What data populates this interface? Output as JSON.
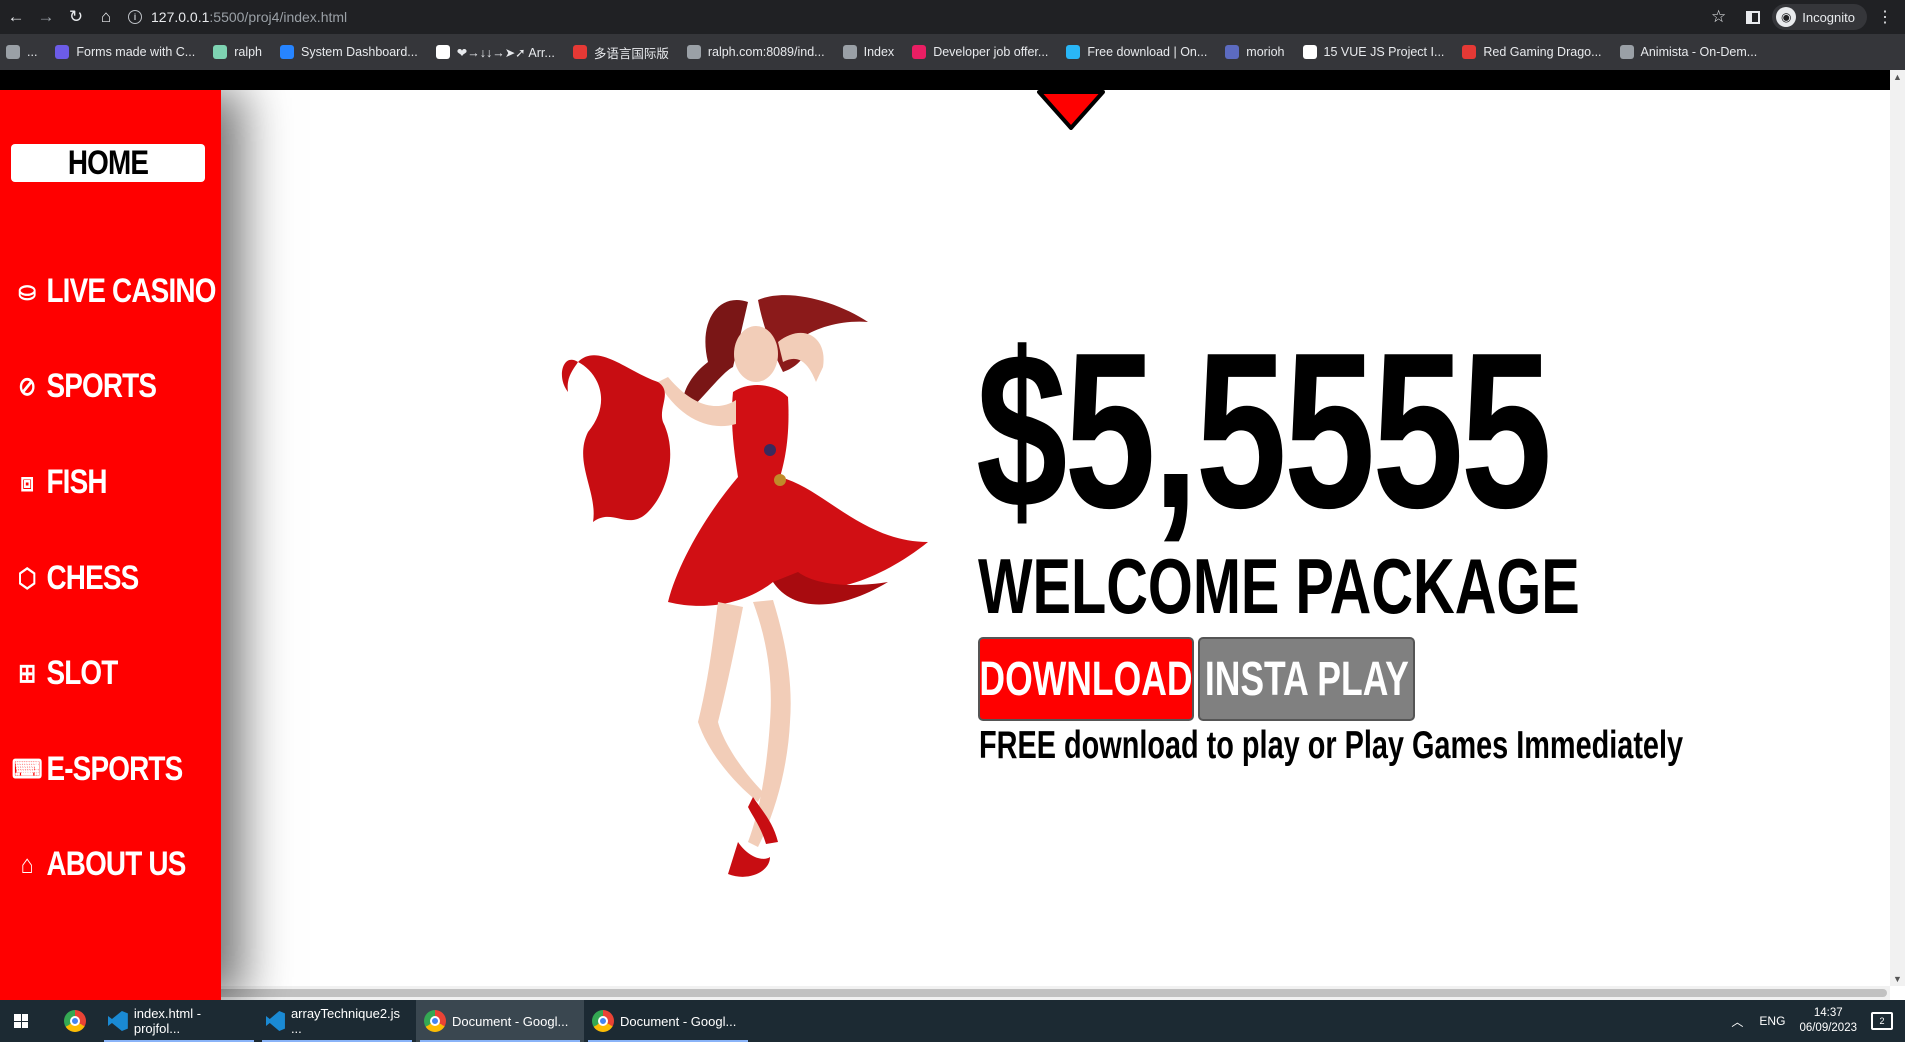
{
  "browser": {
    "url_host": "127.0.0.1",
    "url_path": ":5500/proj4/index.html",
    "profile": "Incognito",
    "bookmarks": [
      {
        "label": "...",
        "color": "#9aa0a6"
      },
      {
        "label": "Forms made with C...",
        "color": "#6c5ce7"
      },
      {
        "label": "ralph",
        "color": "#7ed3b2"
      },
      {
        "label": "System Dashboard...",
        "color": "#2684ff"
      },
      {
        "label": "❤→↓↓→➤➚ Arr...",
        "color": "#ffffff"
      },
      {
        "label": "多语言国际版",
        "color": "#e53935"
      },
      {
        "label": "ralph.com:8089/ind...",
        "color": "#9aa0a6"
      },
      {
        "label": "Index",
        "color": "#9aa0a6"
      },
      {
        "label": "Developer job offer...",
        "color": "#e91e63"
      },
      {
        "label": "Free download | On...",
        "color": "#29b6f6"
      },
      {
        "label": "morioh",
        "color": "#5c6bc0"
      },
      {
        "label": "15 VUE JS Project I...",
        "color": "#ffffff"
      },
      {
        "label": "Red Gaming Drago...",
        "color": "#e53935"
      },
      {
        "label": "Animista - On-Dem...",
        "color": "#9aa0a6"
      }
    ]
  },
  "sidebar": {
    "home": "HOME",
    "items": [
      {
        "label": "LIVE CASINO",
        "icon": "chip-icon",
        "glyph": "⛀"
      },
      {
        "label": "SPORTS",
        "icon": "ball-icon",
        "glyph": "⊘"
      },
      {
        "label": "FISH",
        "icon": "fish-card-icon",
        "glyph": "⧈"
      },
      {
        "label": "CHESS",
        "icon": "chess-icon",
        "glyph": "⬡"
      },
      {
        "label": "SLOT",
        "icon": "gift-icon",
        "glyph": "⊞"
      },
      {
        "label": "E-SPORTS",
        "icon": "keyboard-icon",
        "glyph": "⌨"
      },
      {
        "label": "ABOUT US",
        "icon": "store-icon",
        "glyph": "⌂"
      }
    ]
  },
  "hero": {
    "amount": "$5,5555",
    "headline": "WELCOME PACKAGE",
    "download_label": "DOWNLOAD",
    "insta_label": "INSTA PLAY",
    "tagline": "FREE download to play or Play Games Immediately"
  },
  "colors": {
    "accent": "#ff0000",
    "secondary_button": "#808080",
    "text": "#000000"
  },
  "taskbar": {
    "apps": [
      {
        "label": "",
        "type": "chrome"
      },
      {
        "label": "index.html - projfol...",
        "type": "vscode"
      },
      {
        "label": "arrayTechnique2.js ...",
        "type": "vscode"
      },
      {
        "label": "Document - Googl...",
        "type": "chrome"
      },
      {
        "label": "Document - Googl...",
        "type": "chrome"
      }
    ],
    "language": "ENG",
    "time": "14:37",
    "date": "06/09/2023",
    "notifications": "2"
  }
}
